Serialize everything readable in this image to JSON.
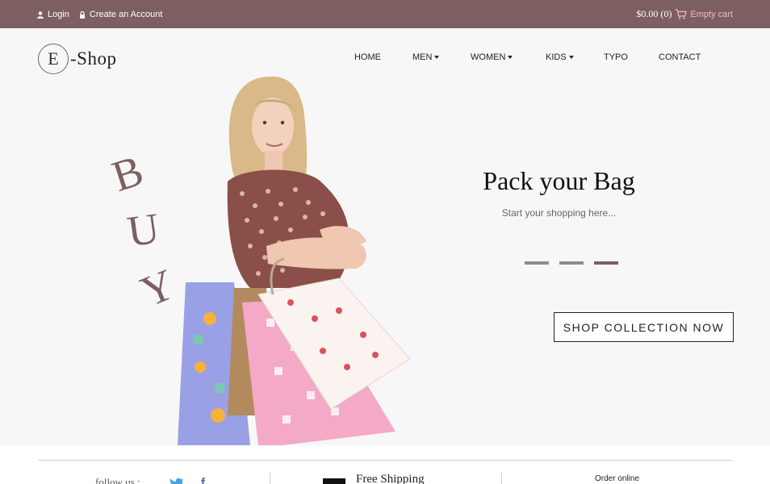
{
  "topbar": {
    "login": "Login",
    "create_account": "Create an Account",
    "cart_price": "$0.00 (0)",
    "cart_status": "Empty cart"
  },
  "logo": {
    "letter": "E",
    "text": "-Shop"
  },
  "nav": {
    "items": [
      {
        "label": "HOME",
        "dropdown": false
      },
      {
        "label": "MEN",
        "dropdown": true
      },
      {
        "label": "WOMEN",
        "dropdown": true
      },
      {
        "label": "KIDS",
        "dropdown": true
      },
      {
        "label": "TYPO",
        "dropdown": false
      },
      {
        "label": "CONTACT",
        "dropdown": false
      }
    ]
  },
  "hero": {
    "buy_letters": [
      "B",
      "U",
      "Y"
    ],
    "title": "Pack your Bag",
    "subtitle": "Start your shopping here...",
    "slide_count": 3,
    "active_slide": 3,
    "cta": "SHOP COLLECTION NOW"
  },
  "footer": {
    "follow": "follow us :",
    "shipping_title": "Free Shipping",
    "order_online": "Order online"
  },
  "colors": {
    "accent": "#7d5f61",
    "cart_text": "#f2b8cc",
    "hero_bg": "#f7f7f7"
  }
}
